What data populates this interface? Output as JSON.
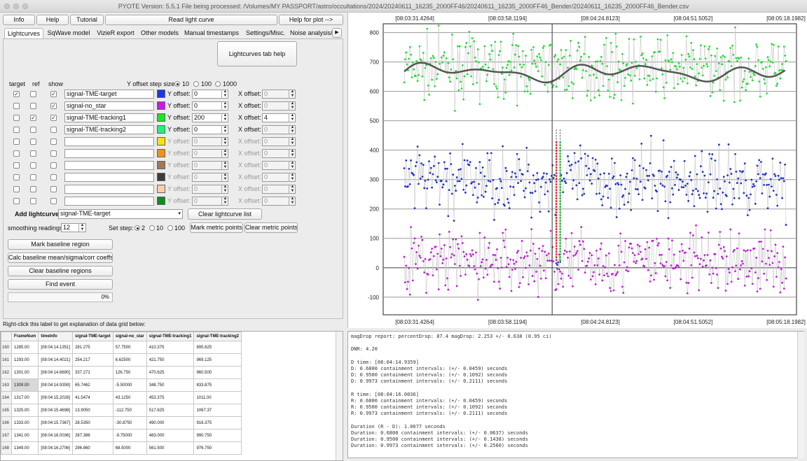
{
  "window": {
    "title": "PYOTE Version: 5.5.1 File being processed: /Volumes/MY PASSPORT/astro/occultations/2024/20240611_16235_2000FF46/20240611_16235_2000FF46_Bender/20240611_16235_2000FF46_Bender.csv"
  },
  "toolbar": {
    "info": "Info",
    "help": "Help",
    "tutorial": "Tutorial",
    "read": "Read light curve",
    "help_plot": "Help for plot -->"
  },
  "tabs": [
    "Lightcurves",
    "SqWave model",
    "VizieR export",
    "Other models",
    "Manual timestamps",
    "Settings/Misc.",
    "Noise analysis/"
  ],
  "lightcurves": {
    "tab_help": "Lightcurves tab help",
    "col_target": "target",
    "col_ref": "ref",
    "col_show": "show",
    "step_label": "Y offset step size:",
    "steps": [
      "10",
      "100",
      "1000"
    ],
    "y_label": "Y offset:",
    "x_label": "X offset:",
    "rows": [
      {
        "name": "signal-TME-target",
        "color": "#1f35e0",
        "target": "✓",
        "ref": "",
        "show": "✓",
        "y": "0",
        "x": "0",
        "active": true
      },
      {
        "name": "signal-no_star",
        "color": "#c81be0",
        "target": "",
        "ref": "",
        "show": "✓",
        "y": "0",
        "x": "0",
        "active": true
      },
      {
        "name": "signal-TME-tracking1",
        "color": "#22e022",
        "target": "",
        "ref": "✓",
        "show": "✓",
        "y": "200",
        "x": "4",
        "active": true
      },
      {
        "name": "signal-TME-tracking2",
        "color": "#26f07a",
        "target": "",
        "ref": "",
        "show": "",
        "y": "0",
        "x": "0",
        "active": true
      },
      {
        "name": "",
        "color": "#f5e01a",
        "target": "",
        "ref": "",
        "show": "",
        "y": "0",
        "x": "0",
        "active": false
      },
      {
        "name": "",
        "color": "#f0901a",
        "target": "",
        "ref": "",
        "show": "",
        "y": "0",
        "x": "0",
        "active": false
      },
      {
        "name": "",
        "color": "#a0785a",
        "target": "",
        "ref": "",
        "show": "",
        "y": "0",
        "x": "0",
        "active": false
      },
      {
        "name": "",
        "color": "#3c3c3c",
        "target": "",
        "ref": "",
        "show": "",
        "y": "0",
        "x": "0",
        "active": false
      },
      {
        "name": "",
        "color": "#f5cfb0",
        "target": "",
        "ref": "",
        "show": "",
        "y": "0",
        "x": "0",
        "active": false
      },
      {
        "name": "",
        "color": "#118a22",
        "target": "",
        "ref": "",
        "show": "",
        "y": "0",
        "x": "0",
        "active": false
      }
    ],
    "add_label": "Add lightcurve",
    "add_value": "signal-TME-target",
    "clear_list": "Clear lightcurve list",
    "smoothing_label": "smoothing readings",
    "smoothing_value": "12",
    "set_step_label": "Set step:",
    "set_steps": [
      "2",
      "10",
      "100"
    ],
    "mark_metric": "Mark metric points",
    "clear_metric": "Clear metric points",
    "mark_baseline": "Mark baseline region",
    "calc_baseline": "Calc baseline mean/sigma/corr coeffs",
    "clear_baseline": "Clear baseline regions",
    "find_event": "Find event",
    "progress": "0%"
  },
  "grid_hint": "Right-click this label to get explanation of data grid below:",
  "table": {
    "headers": [
      "FrameNum",
      "timeInfo",
      "signal-TME-target",
      "signal-no_star",
      "signal-TME-tracking1",
      "signal-TME-tracking2"
    ],
    "rows": [
      [
        "160",
        "1285.00",
        "[08:04:14.1351]",
        "281.275",
        "57.7500",
        "410.375",
        "895.625"
      ],
      [
        "161",
        "1293.00",
        "[08:04:14.4021]",
        "254.217",
        "6.62500",
        "421.750",
        "969.125"
      ],
      [
        "162",
        "1301.00",
        "[08:04:14.6690]",
        "337.271",
        "126.750",
        "470.625",
        "960.500"
      ],
      [
        "163",
        "1309.00",
        "[08:04:14.9359]",
        "65.7462",
        "-5.50000",
        "348.750",
        "833.875"
      ],
      [
        "164",
        "1317.00",
        "[08:04:15.2028]",
        "41.5474",
        "43.1250",
        "453.375",
        "1011.00"
      ],
      [
        "165",
        "1325.00",
        "[08:04:15.4698]",
        "13.9050",
        "-112.750",
        "517.625",
        "1067.37"
      ],
      [
        "166",
        "1333.00",
        "[08:04:15.7367]",
        "28.5350",
        "-30.8750",
        "490.000",
        "916.375"
      ],
      [
        "167",
        "1341.00",
        "[08:04:16.0036]",
        "287.386",
        "-9.75000",
        "483.000",
        "990.750"
      ],
      [
        "168",
        "1349.00",
        "[08:04:16.2706]",
        "296.860",
        "68.5000",
        "561.500",
        "976.750"
      ]
    ]
  },
  "report": "magDrop report: percentDrop: 87.4 magDrop: 2.253 +/- 0.638 (0.95 ci)\n\nDNR: 4.20\n\nD time: [08:04:14.9359]\nD: 0.6800 containment intervals: (+/- 0.0459) seconds\nD: 0.9500 containment intervals: (+/- 0.1092) seconds\nD: 0.9973 containment intervals: (+/- 0.2111) seconds\n\nR time: [08:04:16.0036]\nR: 0.6800 containment intervals: (+/- 0.0459) seconds\nR: 0.9500 containment intervals: (+/- 0.1092) seconds\nR: 0.9973 containment intervals: (+/- 0.2111) seconds\n\nDuration (R - D): 1.0677 seconds\nDuration: 0.6800 containment intervals: (+/- 0.0637) seconds\nDuration: 0.9500 containment intervals: (+/- 0.1438) seconds\nDuration: 0.9973 containment intervals: (+/- 0.2560) seconds",
  "chart_data": {
    "type": "scatter",
    "x_ticks": [
      "[08:03:31.4264]",
      "[08:03:58.1194]",
      "[08:04:24.8123]",
      "[08:04:51.5052]",
      "[08:05:18.1982]"
    ],
    "y_ticks": [
      "800",
      "700",
      "600",
      "500",
      "400",
      "300",
      "200",
      "100",
      "0",
      "-100"
    ],
    "ylim": [
      -160,
      830
    ],
    "x_frame_range": [
      1,
      400
    ],
    "event_frame": 160,
    "series": [
      {
        "name": "signal-TME-tracking1",
        "color": "#22dd33",
        "mean": 680,
        "sigma": 50
      },
      {
        "name": "signal-TME-target",
        "color": "#1f35c8",
        "mean": 295,
        "sigma": 55
      },
      {
        "name": "signal-no_star",
        "color": "#c020d8",
        "mean": 20,
        "sigma": 55
      }
    ],
    "smoothed": {
      "color": "#555555",
      "mean": 665,
      "amplitude": 30
    }
  }
}
